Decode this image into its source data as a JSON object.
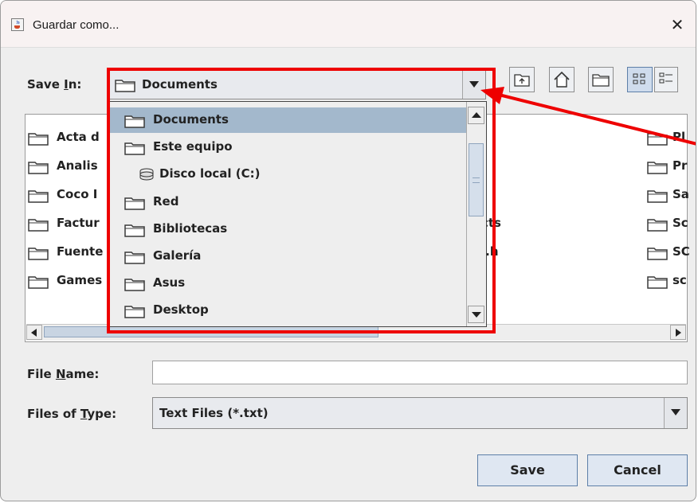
{
  "window": {
    "title": "Guardar como...",
    "close_glyph": "✕"
  },
  "save_in": {
    "label_prefix": "Save ",
    "label_mnemonic": "I",
    "label_suffix": "n:",
    "value": "Documents"
  },
  "file_list": {
    "left_column": [
      "Acta d",
      "Analis",
      "Coco I",
      "Factur",
      "Fuente",
      "Games"
    ],
    "middle_column": [
      "cts",
      "i.h"
    ],
    "right_column": [
      "Pl",
      "Pr",
      "Sa",
      "Sc",
      "SC",
      "sc"
    ]
  },
  "dropdown": {
    "items": [
      {
        "label": "Documents",
        "icon": "folder-icon",
        "indent": 0,
        "selected": true
      },
      {
        "label": "Este equipo",
        "icon": "folder-icon",
        "indent": 0,
        "selected": false
      },
      {
        "label": "Disco local (C:)",
        "icon": "drive-icon",
        "indent": 1,
        "selected": false
      },
      {
        "label": "Red",
        "icon": "folder-icon",
        "indent": 0,
        "selected": false
      },
      {
        "label": "Bibliotecas",
        "icon": "folder-icon",
        "indent": 0,
        "selected": false
      },
      {
        "label": "Galería",
        "icon": "folder-icon",
        "indent": 0,
        "selected": false
      },
      {
        "label": "Asus",
        "icon": "folder-icon",
        "indent": 0,
        "selected": false
      },
      {
        "label": "Desktop",
        "icon": "folder-icon",
        "indent": 0,
        "selected": false
      }
    ]
  },
  "file_name": {
    "label_prefix": "File ",
    "label_mnemonic": "N",
    "label_suffix": "ame:",
    "value": ""
  },
  "files_of_type": {
    "label_prefix": "Files of ",
    "label_mnemonic": "T",
    "label_suffix": "ype:",
    "value": "Text Files (*.txt)"
  },
  "buttons": {
    "save": "Save",
    "cancel": "Cancel"
  },
  "toolbar_icons": [
    "up-one-level-icon",
    "home-icon",
    "new-folder-icon",
    "list-view-icon",
    "details-view-icon"
  ],
  "colors": {
    "annotation": "#ee0000",
    "selection": "#a3b8cc",
    "button_border": "#5d7fa8"
  }
}
